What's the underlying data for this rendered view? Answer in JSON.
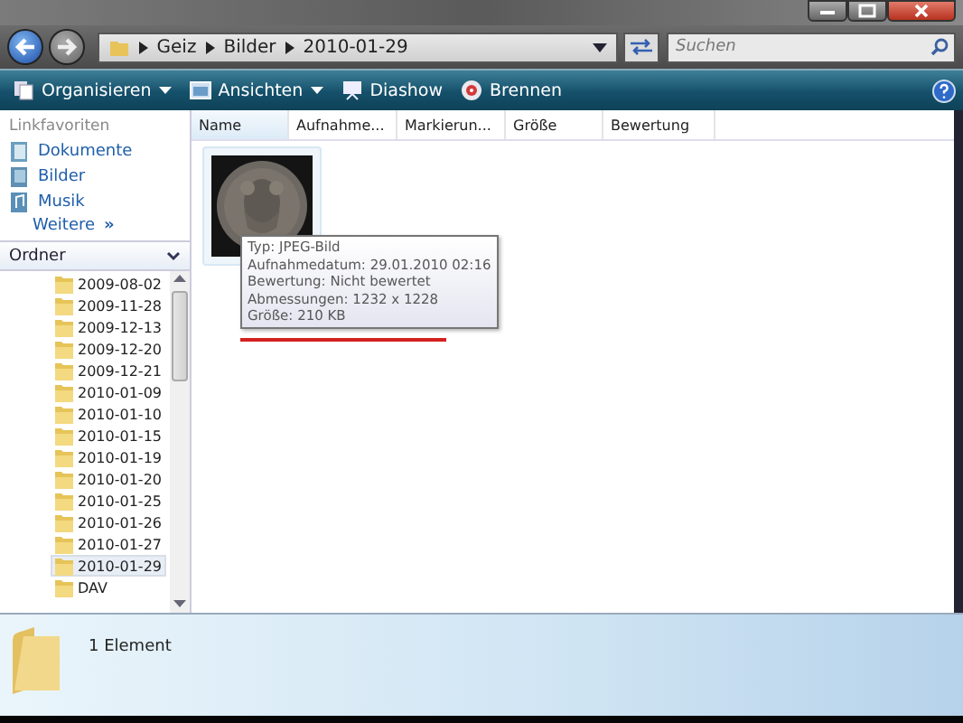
{
  "address": {
    "crumbs": [
      "Geiz",
      "Bilder",
      "2010-01-29"
    ]
  },
  "search": {
    "placeholder": "Suchen"
  },
  "toolbar": [
    {
      "label": "Organisieren",
      "kind": "organize",
      "dropdown": true
    },
    {
      "label": "Ansichten",
      "kind": "views",
      "dropdown": true
    },
    {
      "label": "Diashow",
      "kind": "slideshow",
      "dropdown": false
    },
    {
      "label": "Brennen",
      "kind": "burn",
      "dropdown": false
    }
  ],
  "sidebar": {
    "heading": "Linkfavoriten",
    "links": [
      {
        "label": "Dokumente",
        "kind": "documents"
      },
      {
        "label": "Bilder",
        "kind": "pictures"
      },
      {
        "label": "Musik",
        "kind": "music"
      }
    ],
    "more": "Weitere",
    "more_icon": "»"
  },
  "folders": {
    "heading": "Ordner",
    "items": [
      {
        "label": "2009-08-02",
        "selected": false
      },
      {
        "label": "2009-11-28",
        "selected": false
      },
      {
        "label": "2009-12-13",
        "selected": false
      },
      {
        "label": "2009-12-20",
        "selected": false
      },
      {
        "label": "2009-12-21",
        "selected": false
      },
      {
        "label": "2010-01-09",
        "selected": false
      },
      {
        "label": "2010-01-10",
        "selected": false
      },
      {
        "label": "2010-01-15",
        "selected": false
      },
      {
        "label": "2010-01-19",
        "selected": false
      },
      {
        "label": "2010-01-20",
        "selected": false
      },
      {
        "label": "2010-01-25",
        "selected": false
      },
      {
        "label": "2010-01-26",
        "selected": false
      },
      {
        "label": "2010-01-27",
        "selected": false
      },
      {
        "label": "2010-01-29",
        "selected": true
      },
      {
        "label": "DAV",
        "selected": false
      }
    ]
  },
  "columns": [
    "Name",
    "Aufnahme...",
    "Markierun...",
    "Größe",
    "Bewertung"
  ],
  "tooltip": [
    "Typ: JPEG-Bild",
    "Aufnahmedatum: 29.01.2010 02:16",
    "Bewertung: Nicht bewertet",
    "Abmessungen: 1232 x 1228",
    "Größe: 210 KB"
  ],
  "status_bar": {
    "text": "1 Element"
  }
}
